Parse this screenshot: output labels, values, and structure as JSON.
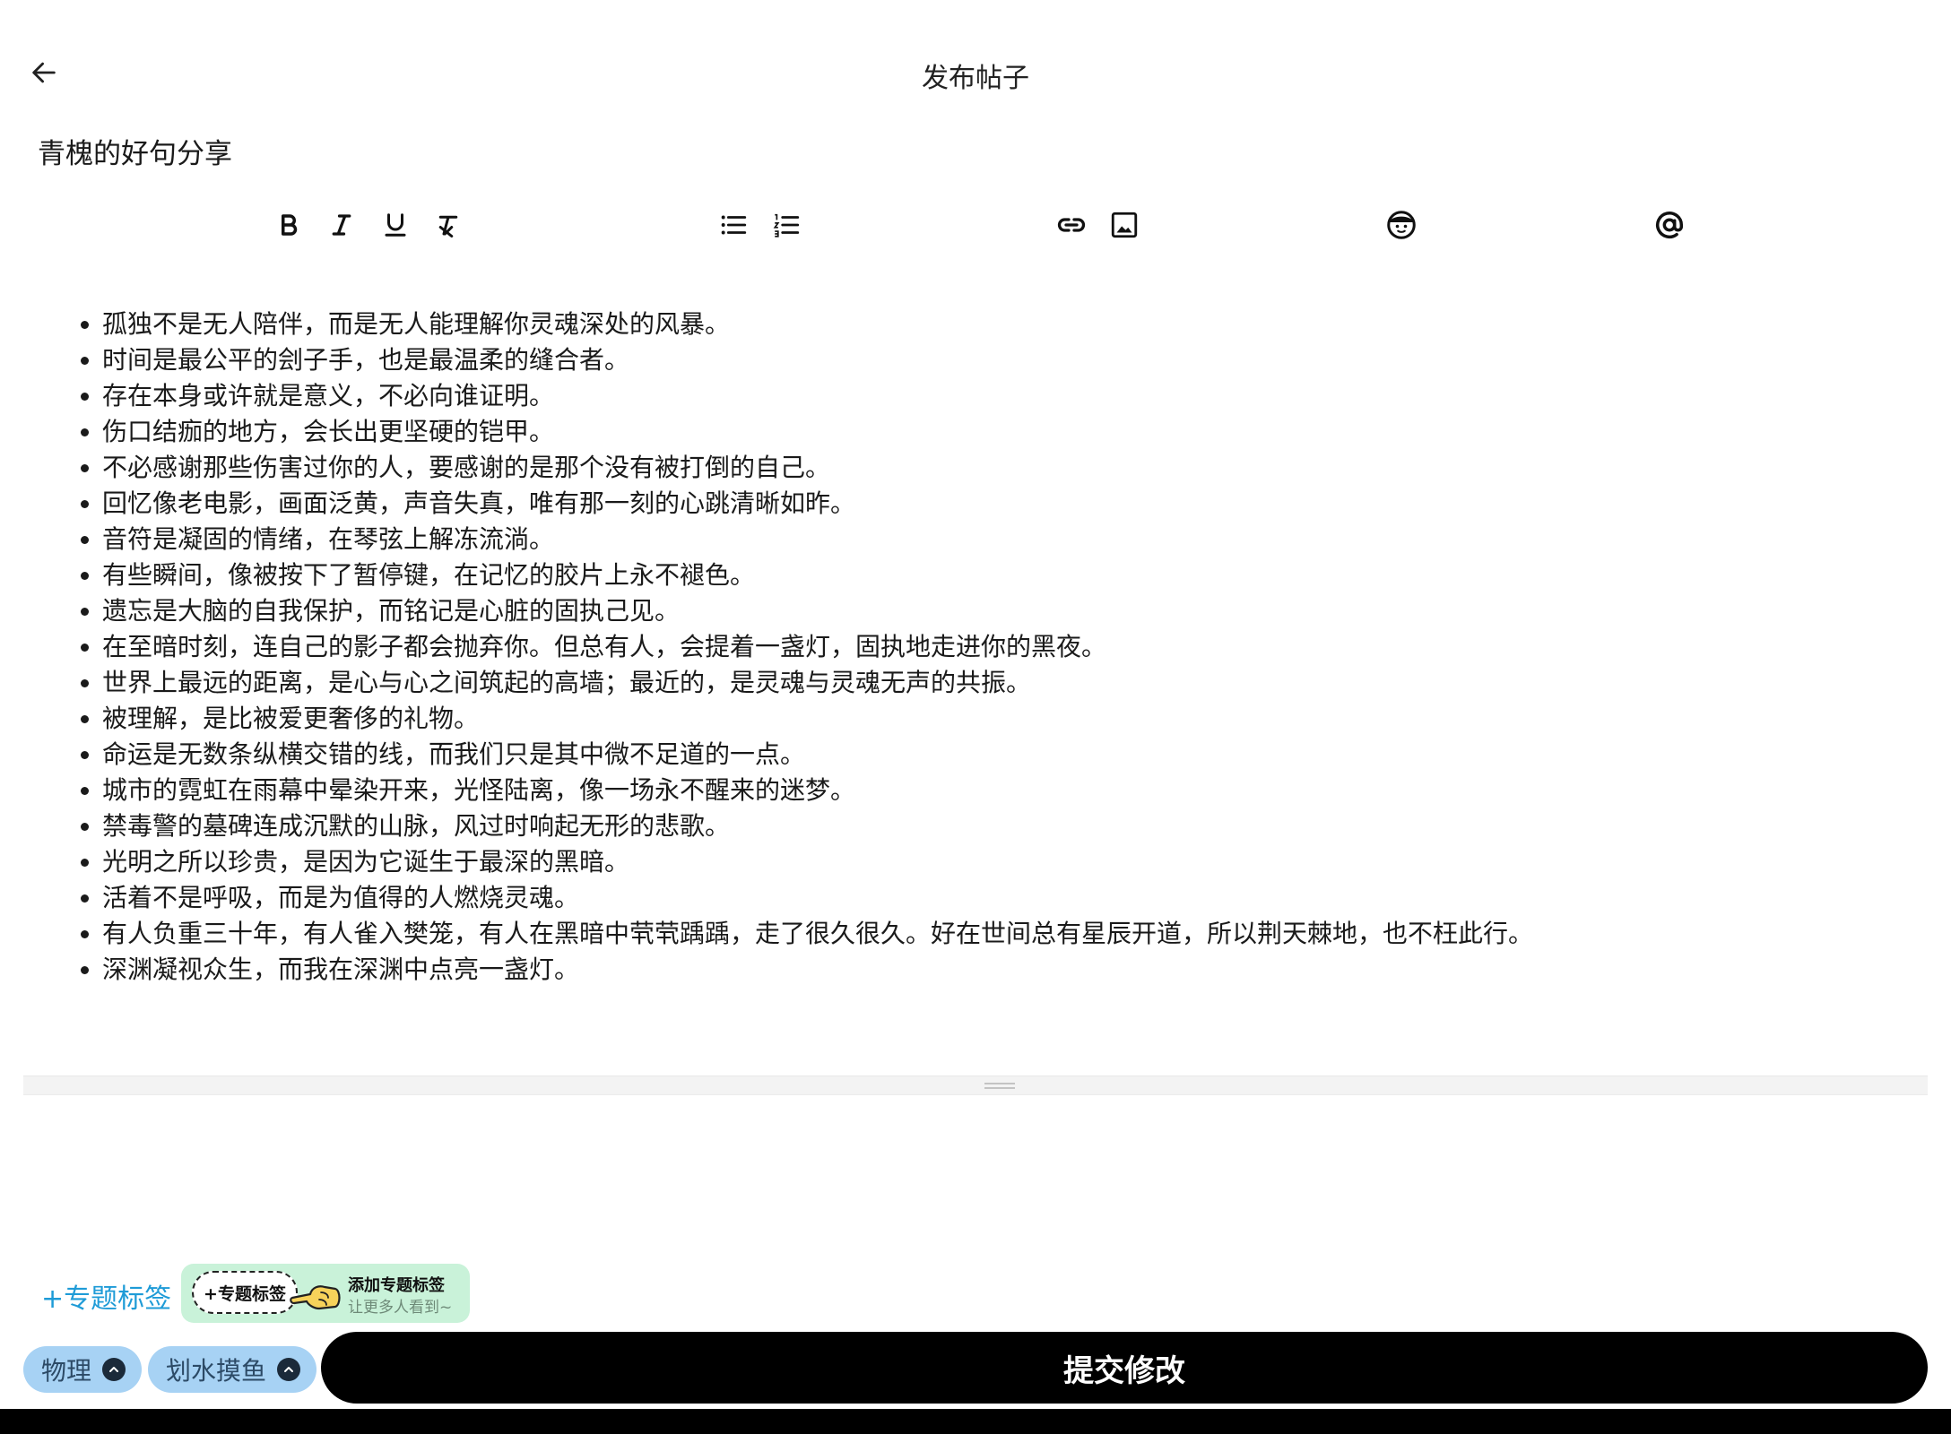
{
  "header": {
    "title": "发布帖子"
  },
  "post": {
    "title": "青槐的好句分享"
  },
  "toolbar": {
    "icons": [
      "bold-icon",
      "italic-icon",
      "underline-icon",
      "clear-format-icon",
      "bullet-list-icon",
      "numbered-list-icon",
      "link-icon",
      "image-icon",
      "emoji-icon",
      "mention-icon"
    ]
  },
  "content": {
    "items": [
      "孤独不是无人陪伴，而是无人能理解你灵魂深处的风暴。",
      "时间是最公平的刽子手，也是最温柔的缝合者。",
      "存在本身或许就是意义，不必向谁证明。",
      "伤口结痂的地方，会长出更坚硬的铠甲。",
      "不必感谢那些伤害过你的人，要感谢的是那个没有被打倒的自己。",
      "回忆像老电影，画面泛黄，声音失真，唯有那一刻的心跳清晰如昨。",
      "音符是凝固的情绪，在琴弦上解冻流淌。",
      "有些瞬间，像被按下了暂停键，在记忆的胶片上永不褪色。",
      "遗忘是大脑的自我保护，而铭记是心脏的固执己见。",
      "在至暗时刻，连自己的影子都会抛弃你。但总有人，会提着一盏灯，固执地走进你的黑夜。",
      "世界上最远的距离，是心与心之间筑起的高墙；最近的，是灵魂与灵魂无声的共振。",
      "被理解，是比被爱更奢侈的礼物。",
      "命运是无数条纵横交错的线，而我们只是其中微不足道的一点。",
      "城市的霓虹在雨幕中晕染开来，光怪陆离，像一场永不醒来的迷梦。",
      "禁毒警的墓碑连成沉默的山脉，风过时响起无形的悲歌。",
      "光明之所以珍贵，是因为它诞生于最深的黑暗。",
      "活着不是呼吸，而是为值得的人燃烧灵魂。",
      "有人负重三十年，有人雀入樊笼，有人在黑暗中茕茕踽踽，走了很久很久。好在世间总有星辰开道，所以荆天棘地，也不枉此行。",
      "深渊凝视众生，而我在深渊中点亮一盏灯。"
    ]
  },
  "topic": {
    "add_label": "+专题标签",
    "hint_button": "+专题标签",
    "hint_title": "添加专题标签",
    "hint_sub": "让更多人看到~"
  },
  "tags": [
    "物理",
    "划水摸鱼"
  ],
  "submit": {
    "label": "提交修改"
  },
  "colors": {
    "accent": "#1e9bd7",
    "chip": "#a7d2f4",
    "hint_bg": "#c9f2d9",
    "submit_bg": "#000000"
  }
}
